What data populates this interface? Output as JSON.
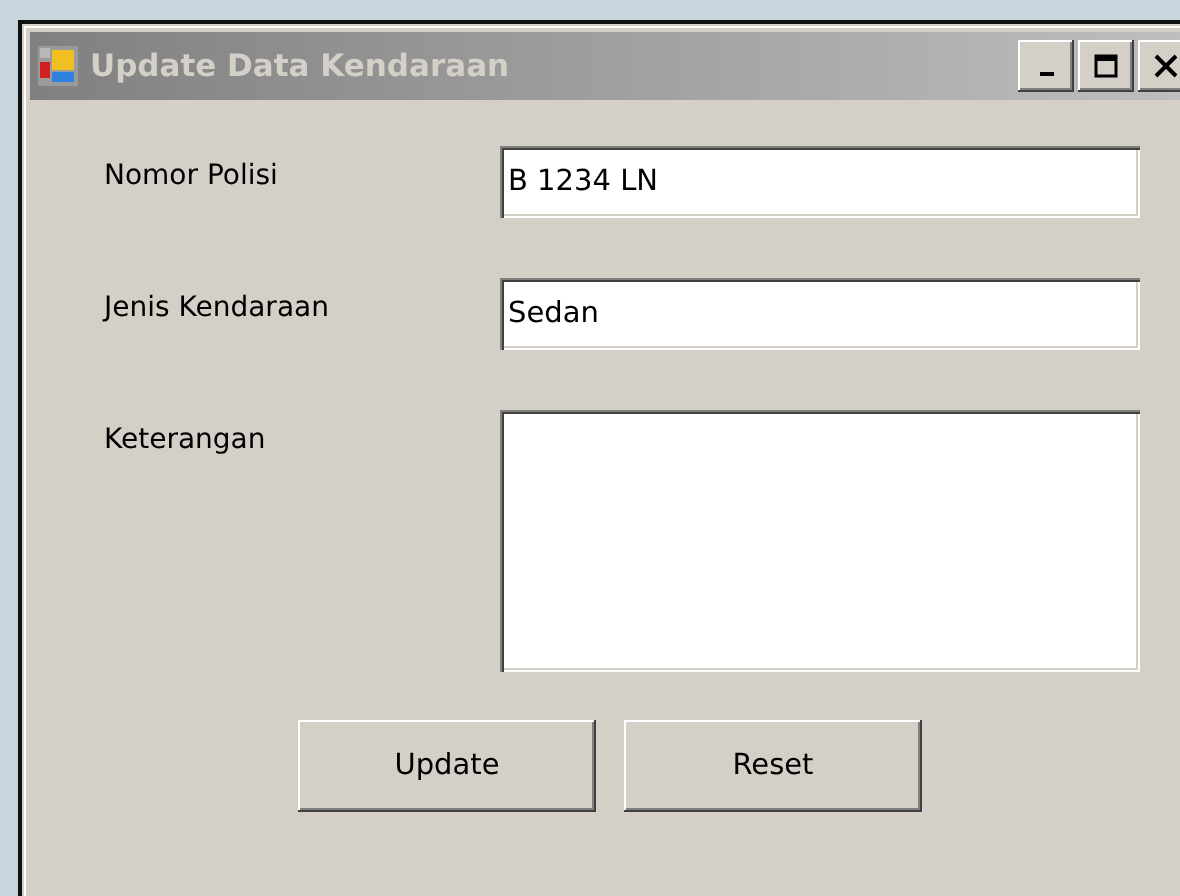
{
  "window": {
    "title": "Update Data Kendaraan",
    "active": false
  },
  "fields": [
    {
      "kind": "text",
      "label": "Nomor Polisi",
      "value": "B 1234 LN"
    },
    {
      "kind": "text",
      "label": "Jenis Kendaraan",
      "value": "Sedan"
    },
    {
      "kind": "multiline",
      "label": "Keterangan"
    }
  ],
  "buttons": [
    "Update",
    "Reset"
  ]
}
